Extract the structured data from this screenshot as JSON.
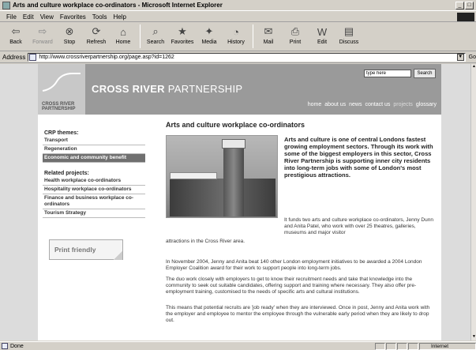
{
  "window": {
    "title": "Arts and culture workplace co-ordinators - Microsoft Internet Explorer"
  },
  "menu": [
    "File",
    "Edit",
    "View",
    "Favorites",
    "Tools",
    "Help"
  ],
  "toolbar": {
    "back": "Back",
    "forward": "Forward",
    "stop": "Stop",
    "refresh": "Refresh",
    "home": "Home",
    "search": "Search",
    "favorites": "Favorites",
    "media": "Media",
    "history": "History",
    "mail": "Mail",
    "print": "Print",
    "edit": "Edit",
    "discuss": "Discuss"
  },
  "address": {
    "label": "Address",
    "url": "http://www.crossriverpartnership.org/page.asp?id=1262",
    "go": "Go"
  },
  "site": {
    "logo_text_1": "CROSS RIVER",
    "logo_text_2": "PARTNERSHIP",
    "title_bold": "CROSS RIVER",
    "title_thin": "PARTNERSHIP",
    "search_placeholder": "type here",
    "search_button": "Search",
    "nav": [
      "home",
      "about us",
      "news",
      "contact us",
      "projects",
      "glossary"
    ]
  },
  "sidebar": {
    "themes_heading": "CRP themes:",
    "themes": [
      "Transport",
      "Regeneration",
      "Economic and community benefit"
    ],
    "related_heading": "Related projects:",
    "related": [
      "Health workplace co-ordinators",
      "Hospitality workplace co-ordinators",
      "Finance and business workplace co-ordinators",
      "Tourism Strategy"
    ],
    "print": "Print friendly"
  },
  "main": {
    "heading": "Arts and culture workplace co-ordinators",
    "lead": "Arts and culture is one of central Londons fastest growing employment sectors. Through its work with some of the biggest employers in this sector, Cross River Partnership is supporting inner city residents into long-term jobs with some of London's most prestigious attractions.",
    "para1": "It funds two arts and culture workplace co-ordinators, Jenny Dunn and Anita Patel, who work with over 25 theatres, galleries, museums and major visitor",
    "para1b": "attractions in the Cross River area.",
    "para2": "In November 2004, Jenny and Anita beat 140 other London employment initiatives to be awarded a 2004 London Employer Coalition award for their work to support people into long-term jobs.",
    "para3": "The duo work closely with employers to get to know their recruitment needs and take that knowledge into the community to seek out suitable candidates, offering support and training where necessary. They also offer pre-employment training, customised to the needs of specific arts and cultural institutions.",
    "para4": "This means that potential recruits are 'job ready' when they are interviewed. Once in post, Jenny and Anita work with the employer and employee to mentor the employee through the vulnerable early period when they are likely to drop out."
  },
  "status": {
    "text": "Done",
    "zone": "Internet"
  }
}
